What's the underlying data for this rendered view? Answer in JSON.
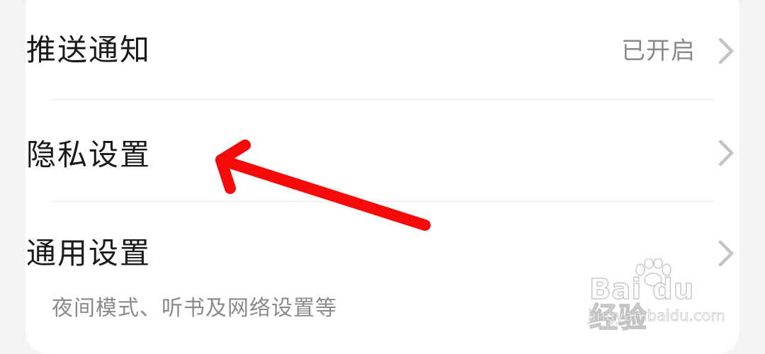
{
  "settings": {
    "rows": [
      {
        "title": "推送通知",
        "value": "已开启",
        "icon": "chevron-right-icon"
      },
      {
        "title": "隐私设置",
        "value": "",
        "icon": "chevron-right-icon"
      },
      {
        "title": "通用设置",
        "subtitle": "夜间模式、听书及网络设置等",
        "icon": "chevron-right-icon"
      }
    ]
  },
  "annotation": {
    "icon": "red-arrow-icon",
    "color": "#f50a0a"
  },
  "watermark": {
    "logo": "Bai du 经验",
    "url": "jingyan.baidu.com",
    "icon": "paw-icon"
  },
  "colors": {
    "background": "#f3f3f3",
    "card": "#ffffff",
    "title": "#1a1a1a",
    "secondary": "#8a8a8a",
    "chevron": "#c4c4c4",
    "divider": "#e6e6e6"
  }
}
